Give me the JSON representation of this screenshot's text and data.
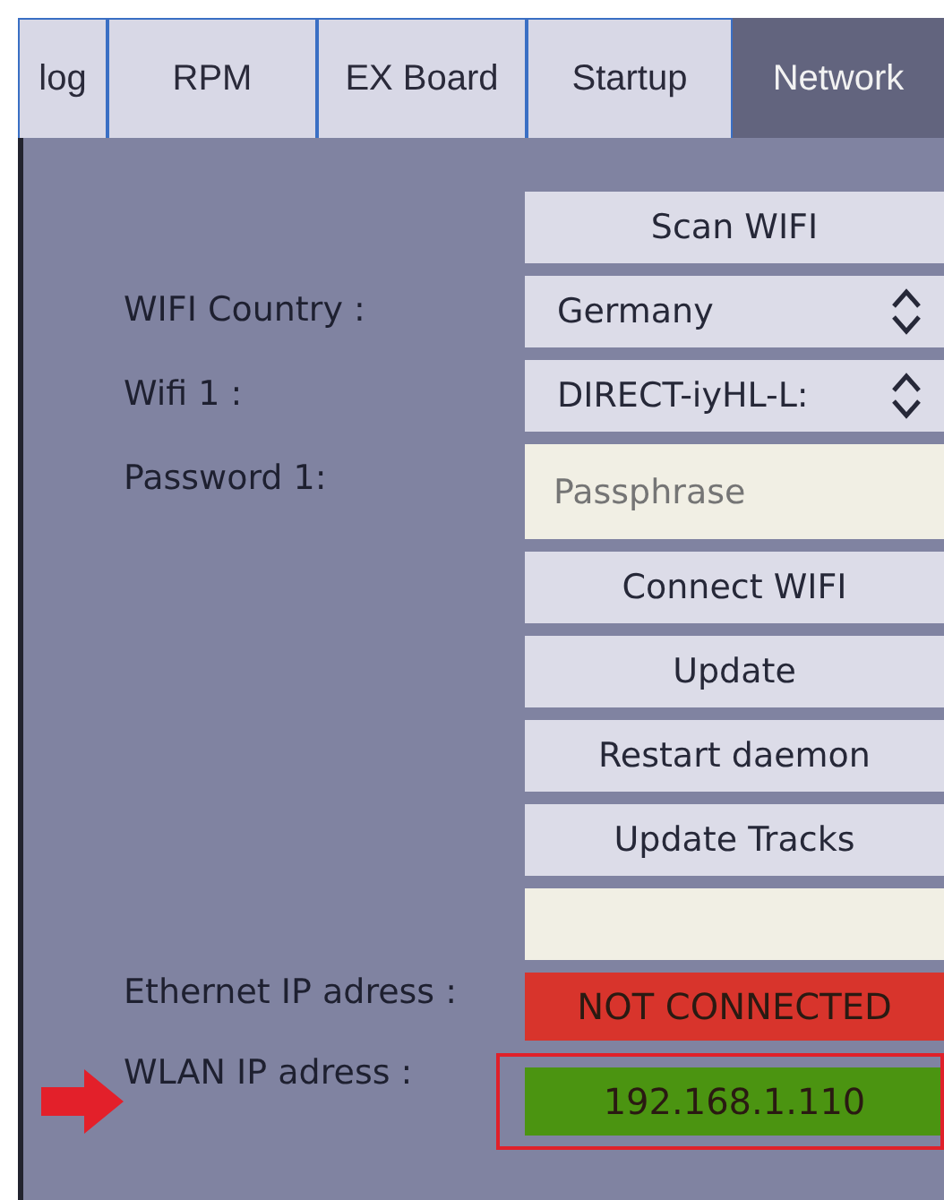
{
  "tabs": [
    {
      "label": "log",
      "selected": false
    },
    {
      "label": "RPM",
      "selected": false
    },
    {
      "label": "EX Board",
      "selected": false
    },
    {
      "label": "Startup",
      "selected": false
    },
    {
      "label": "Network",
      "selected": true
    }
  ],
  "rows": [
    {
      "kind": "button",
      "text": "Scan WIFI"
    },
    {
      "kind": "select",
      "label": "WIFI Country :",
      "value": "Germany"
    },
    {
      "kind": "select",
      "label": "Wifi 1 :",
      "value": "DIRECT-iyHL-L:"
    },
    {
      "kind": "input",
      "label": "Password 1:",
      "placeholder": "Passphrase"
    },
    {
      "kind": "button",
      "text": "Connect WIFI"
    },
    {
      "kind": "button",
      "text": "Update"
    },
    {
      "kind": "button",
      "text": "Restart daemon"
    },
    {
      "kind": "button",
      "text": "Update Tracks"
    },
    {
      "kind": "input"
    },
    {
      "kind": "status",
      "label": "Ethernet IP adress :",
      "value": "NOT CONNECTED",
      "color": "#d8342c",
      "highlighted": false
    },
    {
      "kind": "status",
      "label": "WLAN IP adress :",
      "value": "192.168.1.110",
      "color": "#4b9411",
      "highlighted": true
    }
  ]
}
